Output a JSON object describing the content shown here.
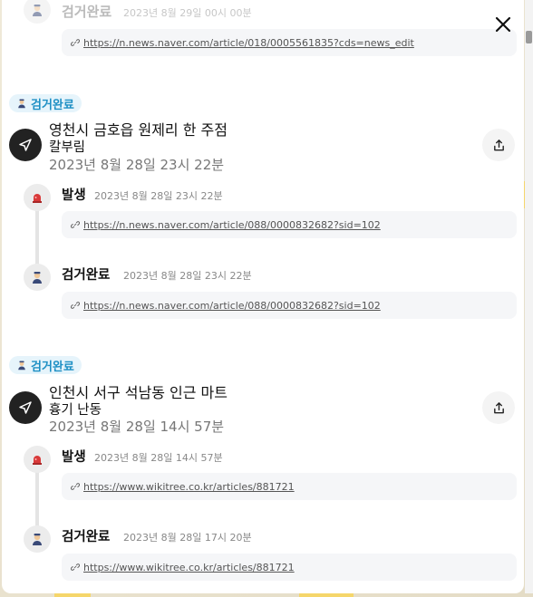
{
  "colors": {
    "badge_bg": "#e6f4fb",
    "badge_text": "#1d8fc4",
    "siren_red": "#d93a3a",
    "police_navy": "#3a4a78"
  },
  "icons": {
    "close": "close-icon",
    "share": "share-icon",
    "location": "location-arrow-icon",
    "siren": "siren-icon",
    "police": "police-officer-icon",
    "link": "link-icon"
  },
  "top_partial": {
    "title": "검거완료",
    "time": "2023년 8월 29일 00시 00분",
    "link": "https://n.news.naver.com/article/018/0005561835?cds=news_edit"
  },
  "incidents": [
    {
      "status": "검거완료",
      "place": "영천시 금호읍 원제리 한 주점",
      "weapon": "칼부림",
      "datetime": "2023년 8월 28일 23시 22분",
      "events": [
        {
          "type": "발생",
          "time": "2023년 8월 28일 23시 22분",
          "link": "https://n.news.naver.com/article/088/0000832682?sid=102"
        },
        {
          "type": "검거완료",
          "time": "2023년 8월 28일 23시 22분",
          "link": "https://n.news.naver.com/article/088/0000832682?sid=102"
        }
      ]
    },
    {
      "status": "검거완료",
      "place": "인천시 서구 석남동 인근 마트",
      "weapon": "흉기 난동",
      "datetime": "2023년 8월 28일 14시 57분",
      "events": [
        {
          "type": "발생",
          "time": "2023년 8월 28일 14시 57분",
          "link": "https://www.wikitree.co.kr/articles/881721"
        },
        {
          "type": "검거완료",
          "time": "2023년 8월 28일 17시 20분",
          "link": "https://www.wikitree.co.kr/articles/881721"
        }
      ]
    }
  ]
}
